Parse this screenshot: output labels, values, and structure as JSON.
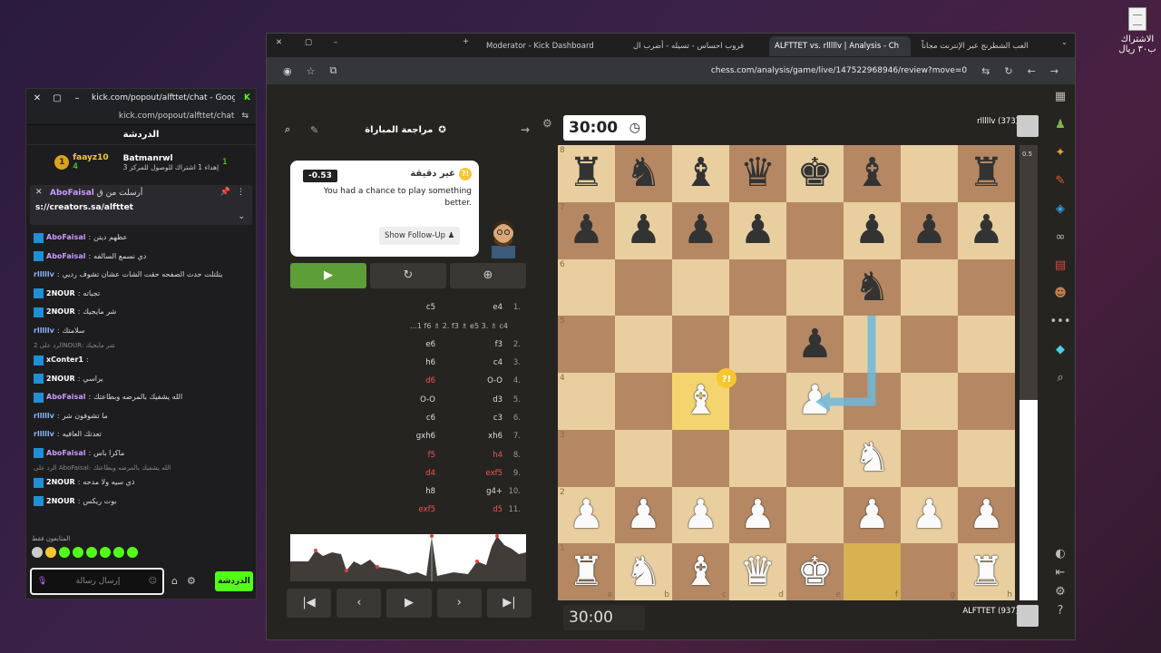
{
  "desktop": {
    "file_label": "الاشتراك ب٣٠ ريال"
  },
  "chat": {
    "window_url": "kick.com/popout/alfttet/chat - Google...",
    "address": "kick.com/popout/alfttet/chat",
    "title": "الدردشة",
    "leaders": [
      {
        "name": "faayz10",
        "count": "4",
        "rank": "1"
      },
      {
        "name": "Batmanrwl",
        "count": "1",
        "subtitle": "إهداء 1 اشتراك للوصول للمركز 3"
      }
    ],
    "pinned": {
      "author": "AboFaisal",
      "prefix": "أرسلت من ق",
      "link": "s://creators.sa/alfttet"
    },
    "messages": [
      {
        "name": "AboFaisal",
        "text": "عظهم ديتن",
        "color": "#c99bff",
        "badge": true
      },
      {
        "name": "AboFaisal",
        "text": "دي نسمع السالفه",
        "color": "#c99bff",
        "badge": true
      },
      {
        "name": "rlllllv",
        "text": "يتلتلت حدث الصفحه حقت الشات عشان تشوف رديي",
        "color": "#8ab4f8",
        "badge": false
      },
      {
        "name": "2NOUR",
        "text": "تجباته",
        "color": "#fff",
        "badge": true
      },
      {
        "name": "2NOUR",
        "text": "شر مايجيك",
        "color": "#fff",
        "badge": true
      },
      {
        "name": "rlllllv",
        "text": "سلامتك",
        "color": "#8ab4f8",
        "badge": false
      },
      {
        "reply": "الرد على 2NOUR: شر مايجيك"
      },
      {
        "name": "xConter1",
        "text": "",
        "color": "#fff",
        "badge": true
      },
      {
        "name": "2NOUR",
        "text": "يراسي",
        "color": "#fff",
        "badge": true
      },
      {
        "name": "AboFaisal",
        "text": "الله يشفيك بالمرضه وبطاعتك",
        "color": "#c99bff",
        "badge": true
      },
      {
        "name": "rlllllv",
        "text": "ما تشوفون شر",
        "color": "#8ab4f8",
        "badge": false
      },
      {
        "name": "rlllllv",
        "text": "تعدتك العافيه",
        "color": "#8ab4f8",
        "badge": false
      },
      {
        "name": "AboFaisal",
        "text": "ماكرا باس",
        "color": "#c99bff",
        "badge": true
      },
      {
        "reply": "الرد على AboFaisal: الله يشفيك بالمرضه وبطاعتك"
      },
      {
        "name": "2NOUR",
        "text": "ذي سيه ولا مدحه",
        "color": "#fff",
        "badge": true
      },
      {
        "name": "2NOUR",
        "text": "بوت ريكس",
        "color": "#fff",
        "badge": true
      }
    ],
    "emote_label": "المتابعون فقط",
    "input_placeholder": "إرسال رسالة",
    "send_label": "الدردشة"
  },
  "browser": {
    "tabs": [
      {
        "label": "Moderator - Kick Dashboard",
        "active": false
      },
      {
        "label": "قروب احساس - تسيله - أضرب ال",
        "active": false
      },
      {
        "label": "ALFTTET vs. rlllllv | Analysis - Ch",
        "active": true
      },
      {
        "label": "العب الشطرنج عبر الإنترنت مجاناً",
        "active": false
      }
    ],
    "url": "chess.com/analysis/game/live/147522968946/review?move=0"
  },
  "review": {
    "title": "مراجعة المباراة",
    "score": "-0.53",
    "heading": "غير دقيقة",
    "text": "You had a chance to play something better.",
    "follow_up": "Show Follow-Up",
    "moves": [
      {
        "num": "1.",
        "w": "e4",
        "b": "c5"
      },
      {
        "var": "…1 f6 ♗ 2. f3 ♗ e5 3. ♗ c4"
      },
      {
        "num": "2.",
        "w": "f3",
        "b": "e6"
      },
      {
        "num": "3.",
        "w": "c4",
        "b": "h6"
      },
      {
        "num": "4.",
        "w": "O-O",
        "b": "d6",
        "bred": true
      },
      {
        "num": "5.",
        "w": "d3",
        "b": "O-O"
      },
      {
        "num": "6.",
        "w": "c3",
        "b": "c6"
      },
      {
        "num": "7.",
        "w": "xh6",
        "b": "gxh6"
      },
      {
        "num": "8.",
        "w": "h4",
        "b": "f5",
        "wred": true,
        "bred": true
      },
      {
        "num": "9.",
        "w": "exf5",
        "b": "d4",
        "wred": true,
        "bred": true
      },
      {
        "num": "10.",
        "w": "g4+",
        "b": "h8"
      },
      {
        "num": "11.",
        "w": "d5",
        "b": "exf5",
        "wred": true,
        "bred": true
      }
    ]
  },
  "game": {
    "clock_top": "30:00",
    "clock_bottom": "30:00",
    "player_top": "rlllllv (373)",
    "player_bottom": "ALFTTET (937)",
    "eval_label": "0.5",
    "eval_white_fraction": 0.44,
    "board": [
      [
        "br",
        "bn",
        "bb",
        "bq",
        "bk",
        "bb",
        "",
        "br"
      ],
      [
        "bp",
        "bp",
        "bp",
        "bp",
        "",
        "bp",
        "bp",
        "bp"
      ],
      [
        "",
        "",
        "",
        "",
        "",
        "bn",
        "",
        ""
      ],
      [
        "",
        "",
        "",
        "",
        "bp",
        "",
        "",
        ""
      ],
      [
        "",
        "",
        "wb",
        "",
        "wp",
        "",
        "",
        ""
      ],
      [
        "",
        "",
        "",
        "",
        "",
        "wn",
        "",
        ""
      ],
      [
        "wp",
        "wp",
        "wp",
        "wp",
        "",
        "wp",
        "wp",
        "wp"
      ],
      [
        "wr",
        "wn",
        "wb",
        "wq",
        "wk",
        "",
        "",
        "wr"
      ]
    ],
    "ranks": [
      "8",
      "7",
      "6",
      "5",
      "4",
      "3",
      "2",
      "1"
    ],
    "files": [
      "a",
      "b",
      "c",
      "d",
      "e",
      "f",
      "g",
      "h"
    ]
  },
  "colors": {
    "kick_green": "#53fc18",
    "board_light": "#e9cfa0",
    "board_dark": "#b58863",
    "accent_green": "#5d9e38"
  }
}
